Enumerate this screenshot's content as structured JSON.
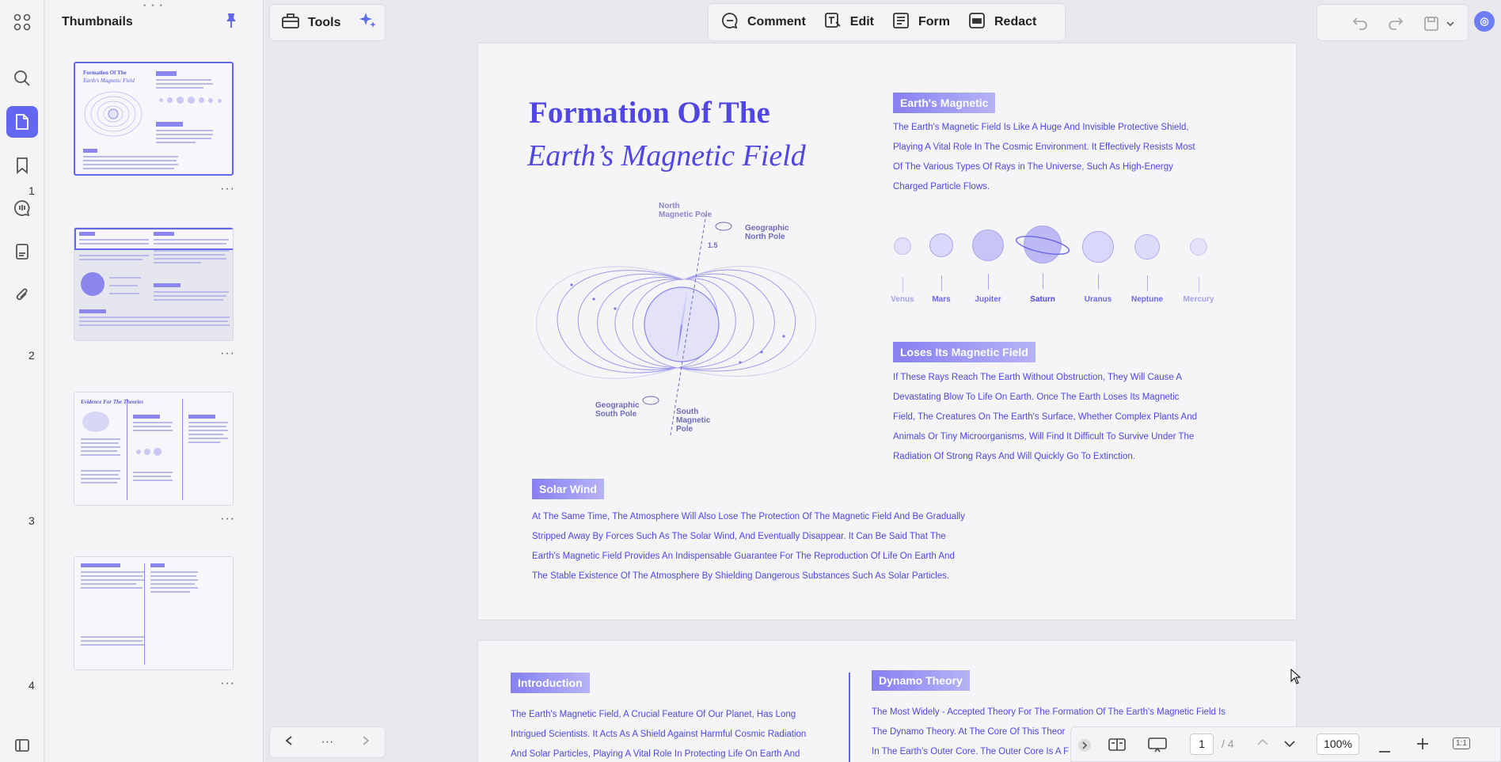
{
  "sidebar_panel": {
    "title": "Thumbnails"
  },
  "thumbnails": [
    {
      "number": "1",
      "title": "Formation Of The",
      "subtitle": "Earth's Magnetic Field"
    },
    {
      "number": "2"
    },
    {
      "number": "3",
      "title": "Evidence For The Theories"
    },
    {
      "number": "4"
    }
  ],
  "toolbar": {
    "tools_label": "Tools",
    "comment_label": "Comment",
    "edit_label": "Edit",
    "form_label": "Form",
    "redact_label": "Redact"
  },
  "page1": {
    "title_line1": "Formation Of The",
    "title_line2": "Earth’s Magnetic Field",
    "section1": {
      "tag": "Earth's Magnetic",
      "lines": [
        "The Earth's Magnetic Field Is Like A Huge And Invisible Protective Shield,",
        "Playing A Vital Role In The Cosmic Environment. It Effectively Resists Most",
        "Of The Various Types Of Rays in The Universe, Such As High-Energy",
        "Charged Particle Flows."
      ]
    },
    "planets": [
      "Venus",
      "Mars",
      "Jupiter",
      "Saturn",
      "Uranus",
      "Neptune",
      "Mercury"
    ],
    "diagram_labels": {
      "north_magnetic": "North Magnetic Pole",
      "geo_north": "Geographic North Pole",
      "geo_south": "Geographic South Pole",
      "south_magnetic": "South Magnetic Pole",
      "angle": "1.5"
    },
    "section2": {
      "tag": "Loses Its Magnetic Field",
      "lines": [
        "If These Rays Reach The Earth Without Obstruction, They Will Cause A",
        "Devastating Blow To Life On Earth. Once The Earth Loses Its Magnetic",
        "Field, The Creatures On The Earth's Surface, Whether Complex Plants And",
        "Animals Or Tiny Microorganisms, Will Find It Difficult To Survive Under The",
        "Radiation Of Strong Rays And Will Quickly Go To Extinction."
      ]
    },
    "section3": {
      "tag": "Solar Wind",
      "lines": [
        "At The Same Time, The Atmosphere Will Also Lose The Protection Of The Magnetic Field And Be Gradually",
        "Stripped Away By Forces Such As The Solar Wind, And Eventually Disappear. It Can Be Said That The",
        "Earth's Magnetic Field Provides An Indispensable Guarantee For The Reproduction Of Life On Earth And",
        "The Stable Existence Of The Atmosphere By Shielding Dangerous Substances Such As Solar Particles."
      ]
    }
  },
  "page2": {
    "intro_tag": "Introduction",
    "intro_lines": [
      "The Earth's Magnetic Field, A Crucial Feature Of Our Planet, Has Long",
      "Intrigued Scientists. It Acts As A Shield Against Harmful Cosmic Radiation",
      "And Solar Particles, Playing A Vital Role In Protecting Life On Earth And"
    ],
    "dynamo_tag": "Dynamo Theory",
    "dynamo_lines": [
      "The Most Widely - Accepted Theory For The Formation Of The Earth's Magnetic Field Is",
      "The Dynamo Theory. At The Core Of This Theor",
      "In The Earth's Outer Core. The Outer Core Is A F"
    ]
  },
  "statusbar": {
    "current_page": "1",
    "total_pages": "/ 4",
    "zoom": "100%",
    "fit_label": "1:1"
  }
}
